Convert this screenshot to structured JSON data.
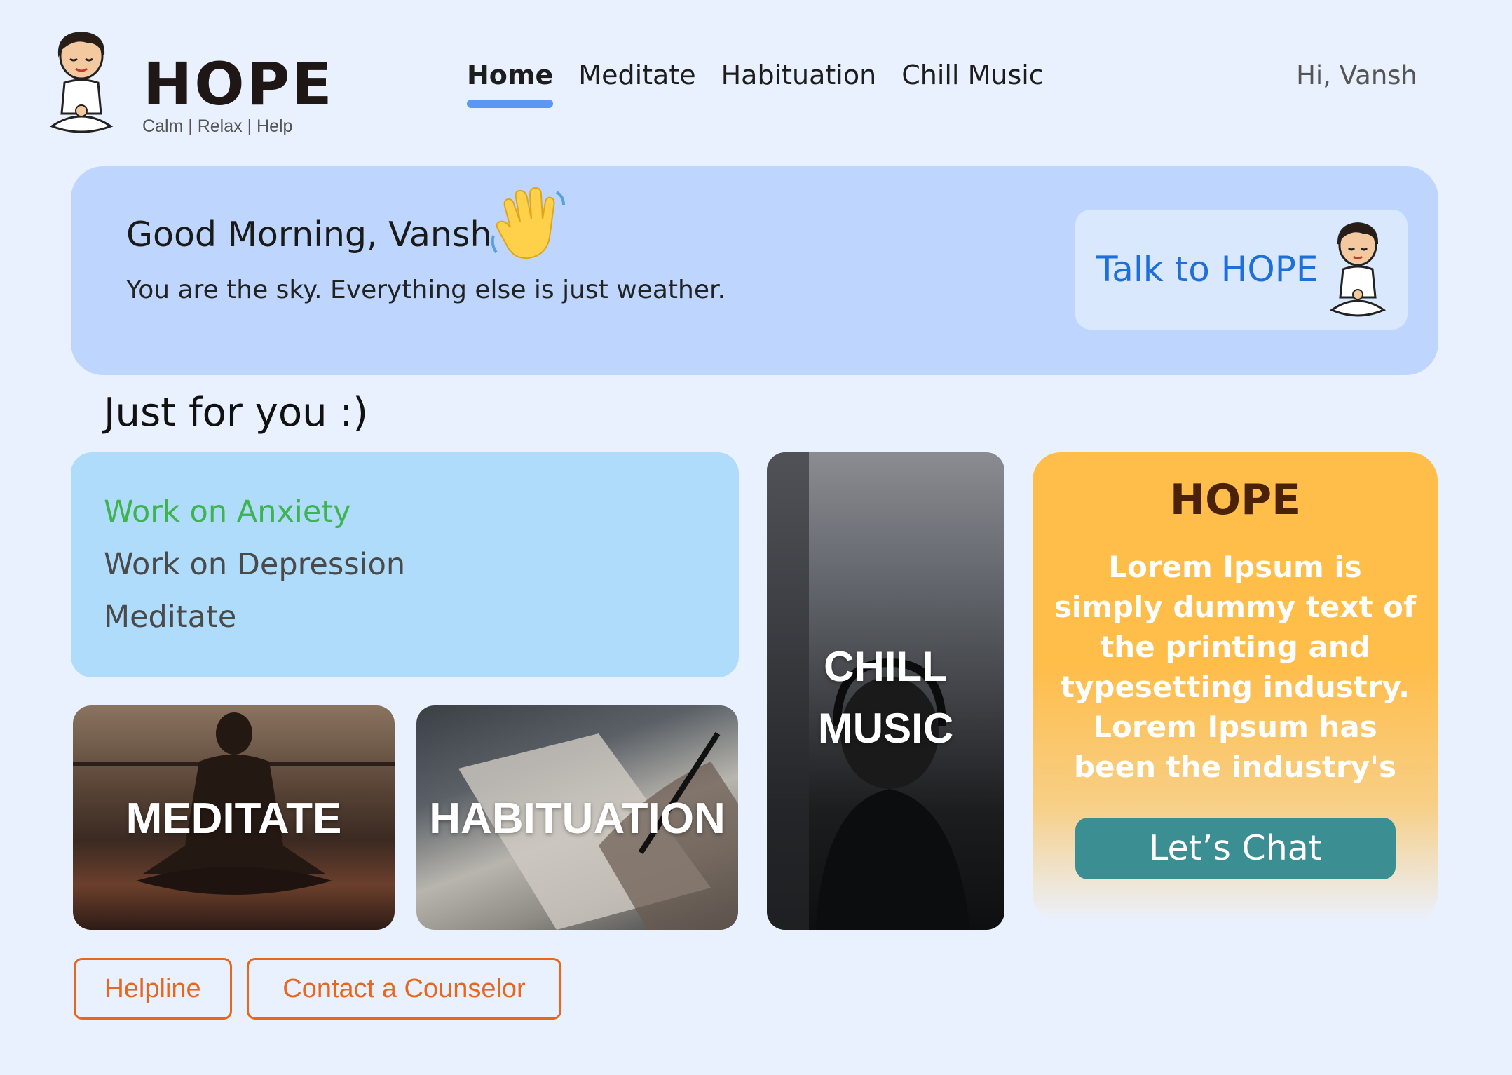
{
  "brand": {
    "name": "HOPE",
    "tagline": "Calm | Relax | Help"
  },
  "nav": {
    "items": [
      {
        "label": "Home",
        "active": true
      },
      {
        "label": "Meditate",
        "active": false
      },
      {
        "label": "Habituation",
        "active": false
      },
      {
        "label": "Chill Music",
        "active": false
      }
    ],
    "user_greeting": "Hi, Vansh"
  },
  "hero": {
    "greeting": "Good Morning, Vansh",
    "quote": "You are the sky. Everything else is just weather.",
    "talk_label": "Talk to HOPE"
  },
  "section": {
    "title": "Just for you :)"
  },
  "focus": {
    "items": [
      "Work on Anxiety",
      "Work on Depression",
      "Meditate"
    ]
  },
  "tiles": {
    "meditate": "MEDITATE",
    "habituation": "HABITUATION",
    "music_line1": "CHILL",
    "music_line2": "MUSIC"
  },
  "hope_card": {
    "title": "HOPE",
    "body": "Lorem Ipsum is simply dummy text of the printing and typesetting industry. Lorem Ipsum has been the industry's",
    "cta": "Let’s Chat"
  },
  "footer_buttons": {
    "helpline": "Helpline",
    "counselor": "Contact a Counselor"
  },
  "colors": {
    "background": "#eaf1fe",
    "hero": "#bed6fd",
    "accent_blue": "#1e6fd9",
    "nav_indicator": "#5b97f3",
    "focus_card": "#b0dcfb",
    "focus_active": "#3fb34f",
    "hope_card": "#ffbd4a",
    "chat_button": "#3b8e91",
    "outline_orange": "#e8661e"
  },
  "icons": {
    "logo": "meditating-boy-avatar",
    "wave": "waving-hand-icon"
  }
}
